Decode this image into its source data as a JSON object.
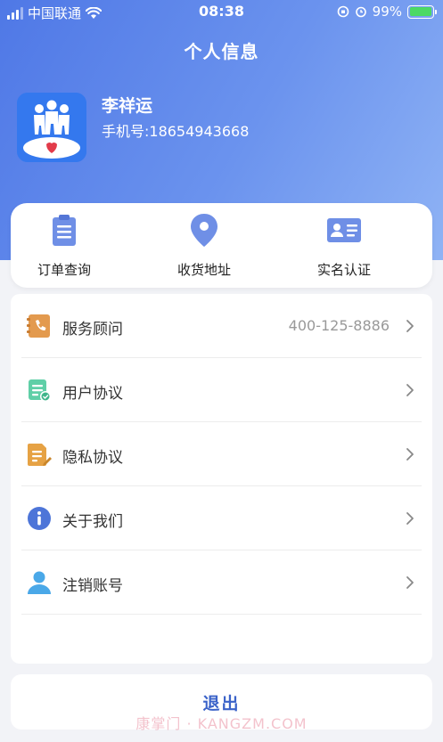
{
  "status_bar": {
    "carrier": "中国联通",
    "time": "08:38",
    "battery": "99%",
    "battery_level": 0.99
  },
  "header": {
    "title": "个人信息"
  },
  "profile": {
    "name": "李祥运",
    "phone": "手机号:18654943668",
    "avatar_badge": "UMF"
  },
  "quick_actions": [
    {
      "label": "订单查询",
      "icon": "clipboard-icon"
    },
    {
      "label": "收货地址",
      "icon": "location-pin-icon"
    },
    {
      "label": "实名认证",
      "icon": "id-card-icon"
    }
  ],
  "menu": [
    {
      "label": "服务顾问",
      "value": "400-125-8886",
      "icon": "phone-book-icon",
      "color": "#e39a4e"
    },
    {
      "label": "用户协议",
      "value": "",
      "icon": "agreement-doc-icon",
      "color": "#5fcfa7"
    },
    {
      "label": "隐私协议",
      "value": "",
      "icon": "privacy-doc-icon",
      "color": "#e6a244"
    },
    {
      "label": "关于我们",
      "value": "",
      "icon": "info-icon",
      "color": "#4d75d8"
    },
    {
      "label": "注销账号",
      "value": "",
      "icon": "user-icon",
      "color": "#4aa8e8"
    }
  ],
  "logout": {
    "label": "退出"
  },
  "watermark": "康掌门 · KANGZM.COM",
  "colors": {
    "header_start": "#4f78e6",
    "header_end": "#8fb3f5",
    "accent": "#3b63c9",
    "icon_blue": "#6f8fe6"
  }
}
